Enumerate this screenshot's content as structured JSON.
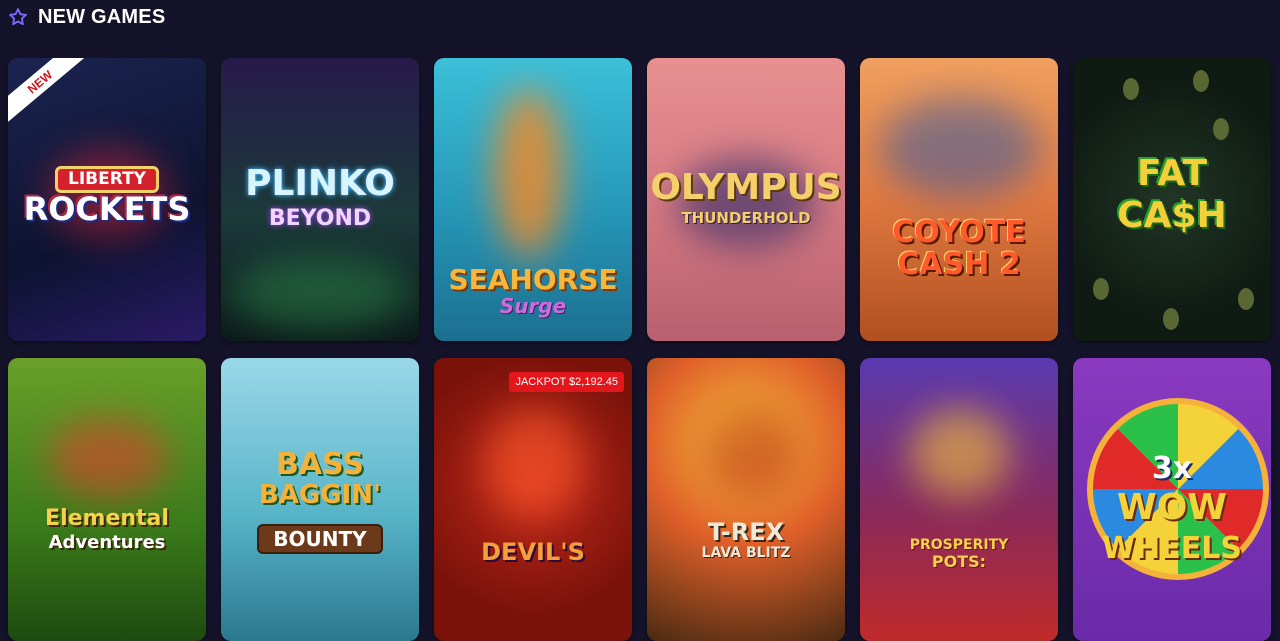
{
  "section": {
    "title": "NEW GAMES",
    "icon": "star-icon"
  },
  "games": [
    {
      "name": "Liberty Rockets",
      "logo_lines": [
        "LIBERTY",
        "ROCKETS"
      ],
      "badge": "NEW"
    },
    {
      "name": "Plinko Beyond",
      "logo_lines": [
        "PLINKO",
        "BEYOND"
      ]
    },
    {
      "name": "Seahorse Surge",
      "logo_lines": [
        "SEAHORSE",
        "Surge"
      ]
    },
    {
      "name": "Olympus Thunderhold",
      "logo_lines": [
        "OLYMPUS",
        "THUNDERHOLD"
      ]
    },
    {
      "name": "Coyote Cash 2",
      "logo_lines": [
        "COYOTE",
        "CASH 2"
      ]
    },
    {
      "name": "Fat Cash",
      "logo_lines": [
        "FAT",
        "CA$H"
      ]
    },
    {
      "name": "Elemental Adventures",
      "logo_lines": [
        "Elemental",
        "Adventures"
      ]
    },
    {
      "name": "Bass Baggin' Bounty",
      "logo_lines": [
        "BASS",
        "BAGGIN'",
        "BOUNTY"
      ]
    },
    {
      "name": "Devil's",
      "logo_lines": [
        "DEVIL'S"
      ],
      "jackpot": "JACKPOT $2,192.45"
    },
    {
      "name": "T-Rex Lava Blitz",
      "logo_lines": [
        "T-REX",
        "LAVA BLITZ"
      ]
    },
    {
      "name": "Prosperity Pots",
      "logo_lines": [
        "PROSPERITY",
        "POTS:"
      ]
    },
    {
      "name": "3x Wow Wheels",
      "logo_lines": [
        "3x",
        "WOW",
        "WHEELS"
      ]
    }
  ]
}
